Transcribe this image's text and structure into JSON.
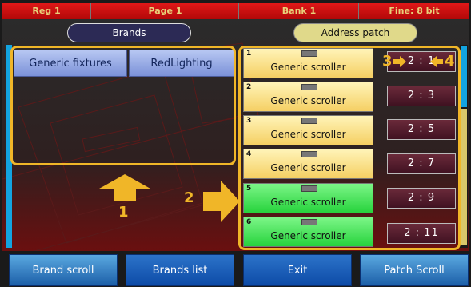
{
  "status_bar": {
    "register": "Reg 1",
    "page": "Page 1",
    "bank": "Bank 1",
    "fine": "Fine: 8 bit"
  },
  "brands_header": "Brands",
  "patch_header": "Address patch",
  "brand_buttons": [
    "Generic fixtures",
    "RedLighting"
  ],
  "fixtures": [
    {
      "num": "1",
      "label": "Generic scroller",
      "state": "yellow",
      "address": "2 : 1"
    },
    {
      "num": "2",
      "label": "Generic scroller",
      "state": "yellow",
      "address": "2 : 3"
    },
    {
      "num": "3",
      "label": "Generic scroller",
      "state": "yellow",
      "address": "2 : 5"
    },
    {
      "num": "4",
      "label": "Generic scroller",
      "state": "yellow",
      "address": "2 : 7"
    },
    {
      "num": "5",
      "label": "Generic scroller",
      "state": "green",
      "address": "2 : 9"
    },
    {
      "num": "6",
      "label": "Generic scroller",
      "state": "green",
      "address": "2 : 11"
    }
  ],
  "annotations": [
    "1",
    "2",
    "3",
    "4"
  ],
  "bottom_buttons": [
    "Brand scroll",
    "Brands list",
    "Exit",
    "Patch Scroll"
  ],
  "colors": {
    "accent": "#f0b628",
    "status_bar": "#c81010",
    "brand_button": "#9aaee6",
    "fixture_selected": "#f5d46b",
    "fixture_active": "#3bdc4a"
  }
}
